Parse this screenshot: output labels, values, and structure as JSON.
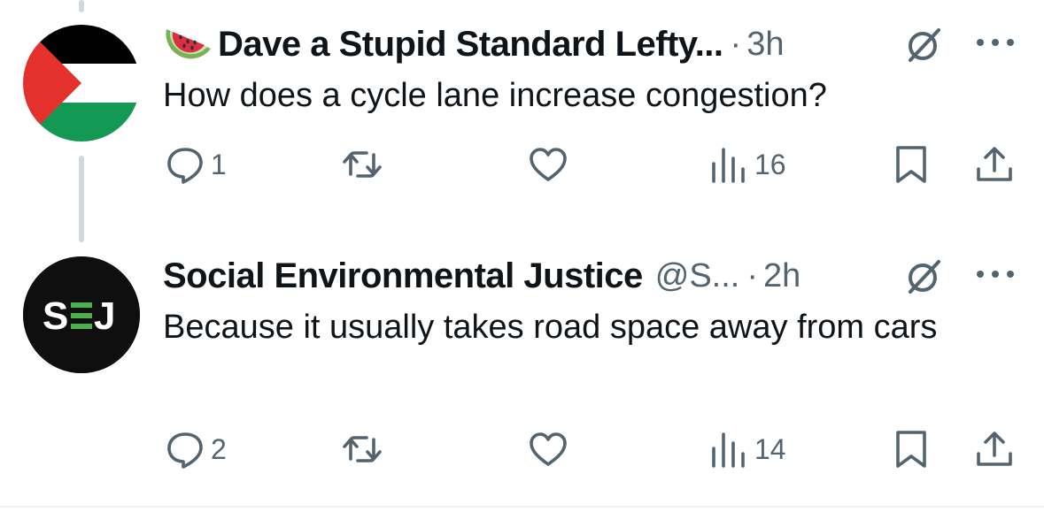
{
  "colors": {
    "text_primary": "#0f1419",
    "text_secondary": "#536471",
    "thread_line": "#cfd9de",
    "palestine_black": "#000000",
    "palestine_white": "#ffffff",
    "palestine_green": "#149954",
    "palestine_red": "#e4312b",
    "sej_green": "#4caf50"
  },
  "tweets": [
    {
      "emoji": "watermelon",
      "display_name": "Dave a Stupid Standard Lefty...",
      "handle": "",
      "separator": "·",
      "time": "3h",
      "text": "How does a cycle lane increase congestion?",
      "avatar": "palestine-flag",
      "actions": {
        "reply_count": "1",
        "retweet_count": "",
        "like_count": "",
        "views_count": "16"
      }
    },
    {
      "emoji": "",
      "display_name": "Social Environmental Justice",
      "handle": "@S...",
      "separator": "·",
      "time": "2h",
      "text": "Because it usually takes road space away from cars",
      "avatar": "sej-logo",
      "avatar_text": "SEJ",
      "actions": {
        "reply_count": "2",
        "retweet_count": "",
        "like_count": "",
        "views_count": "14"
      }
    }
  ],
  "icons": [
    "reply-icon",
    "retweet-icon",
    "like-icon",
    "views-icon",
    "bookmark-icon",
    "share-icon",
    "grok-icon",
    "more-icon"
  ]
}
